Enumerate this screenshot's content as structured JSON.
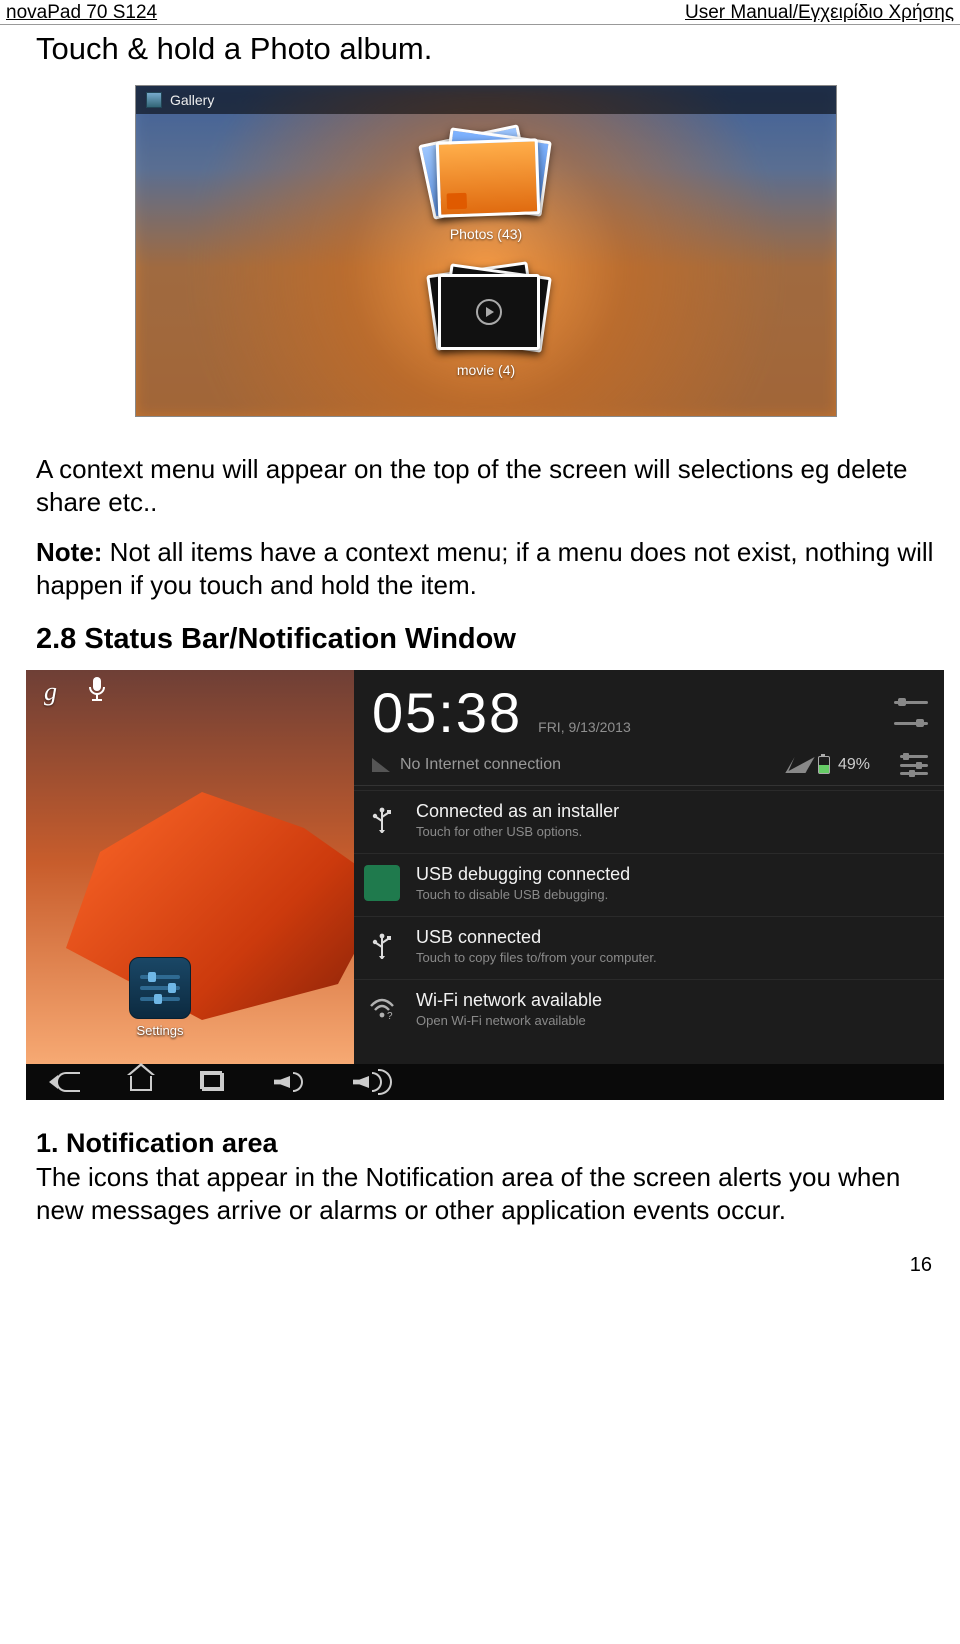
{
  "header": {
    "left": "novaPad 70 S124",
    "right": "User Manual/Εγχειρίδιο Χρήσης"
  },
  "intro_title": "Touch & hold a Photo album.",
  "gallery": {
    "app_label": "Gallery",
    "album_photos_label": "Photos (43)",
    "album_movie_label": "movie (4)"
  },
  "para_context": "A context menu will appear on the top of the screen will selections eg delete share etc..",
  "note_label": "Note:",
  "note_body": " Not all items have a context menu; if a menu does not exist, nothing will happen if you touch and hold the item.",
  "section28": "2.8 Status Bar/Notification Window",
  "notif": {
    "google_glyph": "g",
    "mic_glyph": "🎤",
    "settings_label": "Settings",
    "clock": "05:38",
    "date": "FRI, 9/13/2013",
    "no_internet": "No Internet connection",
    "battery_pct": "49%",
    "items": [
      {
        "icon": "usb",
        "title": "Connected as an installer",
        "sub": "Touch for other USB options."
      },
      {
        "icon": "android",
        "title": "USB debugging connected",
        "sub": "Touch to disable USB debugging."
      },
      {
        "icon": "usb",
        "title": "USB connected",
        "sub": "Touch to copy files to/from your computer."
      },
      {
        "icon": "wifi",
        "title": "Wi-Fi network available",
        "sub": "Open Wi-Fi network available"
      }
    ]
  },
  "section_notif_area_heading": "1. Notification area",
  "section_notif_area_body": "The icons that appear in the Notification area of the screen alerts you when new messages arrive or alarms or other application events occur.",
  "page_number": "16"
}
